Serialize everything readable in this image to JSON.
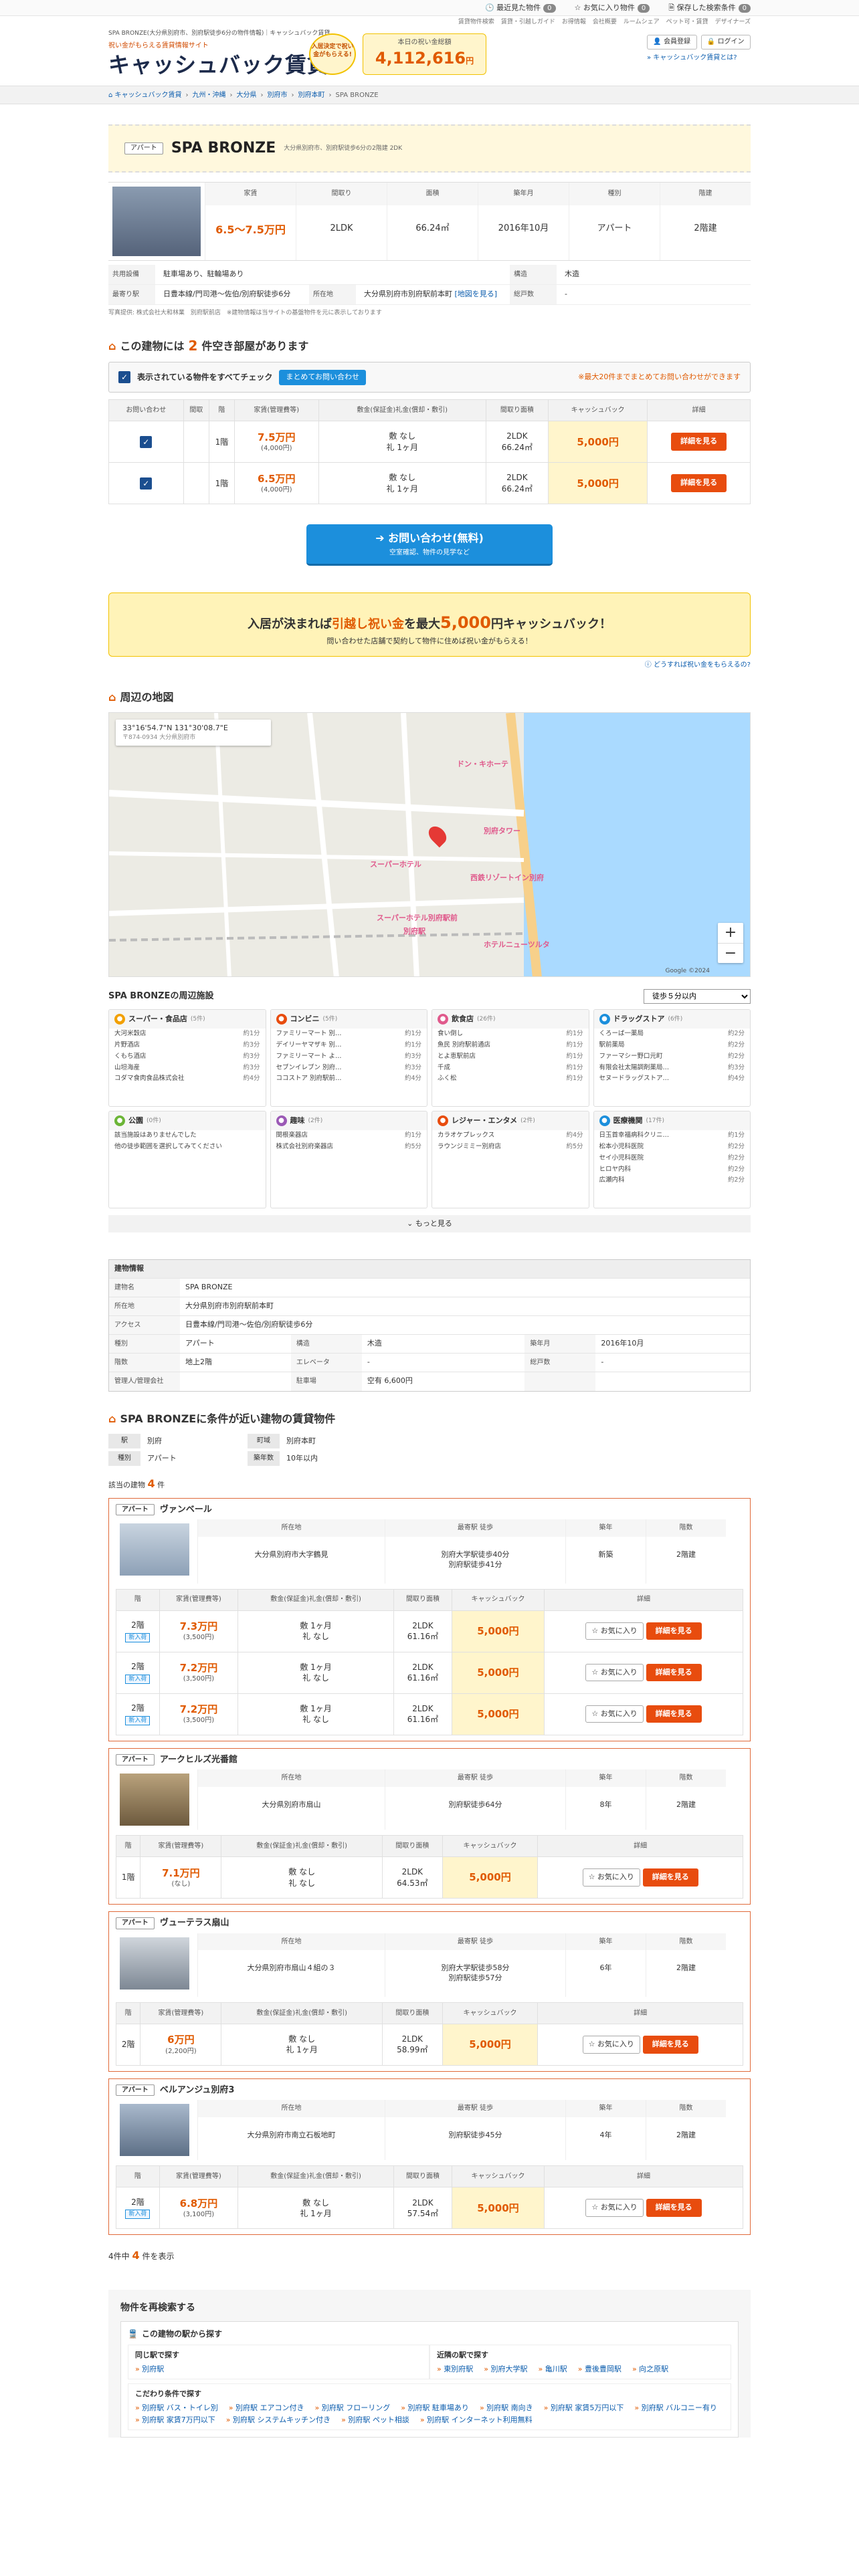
{
  "util": {
    "recent": "最近見た物件",
    "recent_count": "0",
    "fav": "お気に入り物件",
    "fav_count": "0",
    "saved": "保存した検索条件",
    "saved_count": "0"
  },
  "mini_links": [
    "賃貸物件検索",
    "賃貸・引越しガイド",
    "お得情報",
    "会社概要",
    "ルームシェア",
    "ペット可・賃貸",
    "デザイナーズ"
  ],
  "header": {
    "tagline": "SPA BRONZE(大分県別府市、別府駅徒歩6分の物件情報)｜キャッシュバック賃貸",
    "logo_sub": "祝い金がもらえる賃貸情報サイト",
    "logo": "キャッシュバック賃貸",
    "badge": "入居決定で祝い金がもらえる!",
    "total_cap": "本日の祝い金総額",
    "total_num": "4,112,616",
    "total_unit": "円",
    "member": "会員登録",
    "login": "ログイン",
    "about": "キャッシュバック賃貸とは?"
  },
  "breadcrumb": [
    "キャッシュバック賃貸",
    "九州・沖縄",
    "大分県",
    "別府市",
    "別府本町",
    "SPA BRONZE"
  ],
  "building": {
    "tag": "アパート",
    "name": "SPA BRONZE",
    "addr": "大分県別府市、別府駅徒歩6分の2階建 2DK",
    "price": "6.5〜7.5万円",
    "layout": "2LDK",
    "area": "66.24㎡",
    "built": "2016年10月",
    "type": "アパート",
    "floors": "2階建",
    "shared": "駐車場あり、駐輪場あり",
    "structure_k": "構造",
    "structure": "木造",
    "station_k": "最寄り駅",
    "station": "日豊本線/門司港〜佐伯/別府駅徒歩6分",
    "loc_k": "所在地",
    "loc": "大分県別府市別府駅前本町",
    "map_link": "[地図を見る]",
    "units_k": "総戸数",
    "units": "-",
    "note1": "写真提供: 株式会社大和林業　別府駅前店　※建物情報は当サイトの基盤物件を元に表示しております"
  },
  "sum_headers": [
    "家賃",
    "間取り",
    "面積",
    "築年月",
    "種別",
    "階建"
  ],
  "shared_k": "共用設備",
  "rooms_title_pre": "この建物には",
  "rooms_count": "2",
  "rooms_title_post": "件空き部屋があります",
  "checkbar": {
    "check_all": "表示されている物件をすべてチェック",
    "bulk": "まとめてお問い合わせ",
    "note": "※最大20件までまとめてお問い合わせができます"
  },
  "room_headers": [
    "お問い合わせ",
    "間取",
    "階",
    "家賃(管理費等)",
    "敷金(保証金)礼金(償却・敷引)",
    "間取り面積",
    "キャッシュバック",
    "詳細"
  ],
  "rooms": [
    {
      "floor": "1階",
      "rent": "7.5万円",
      "mgmt": "(4,000円)",
      "deposit": "敷 なし",
      "key": "礼 1ヶ月",
      "layout": "2LDK",
      "area": "66.24㎡",
      "cb": "5,000円",
      "detail": "詳細を見る"
    },
    {
      "floor": "1階",
      "rent": "6.5万円",
      "mgmt": "(4,000円)",
      "deposit": "敷 なし",
      "key": "礼 1ヶ月",
      "layout": "2LDK",
      "area": "66.24㎡",
      "cb": "5,000円",
      "detail": "詳細を見る"
    }
  ],
  "inquiry": {
    "main": "お問い合わせ(無料)",
    "sub": "空室確認、物件の見学など"
  },
  "banner": {
    "pre": "入居が決まれば",
    "hl": "引越し祝い金",
    "mid": "を最大",
    "amount": "5,000",
    "post": "円キャッシュバック！",
    "sub": "問い合わせた店舗で契約して物件に住めば祝い金がもらえる！",
    "link": "どうすれば祝い金をもらえるの?"
  },
  "map": {
    "title": "周辺の地図",
    "coord": "33°16'54.7\"N 131°30'08.7\"E",
    "coord_sub": "〒874-0934 大分県別府市",
    "labels": [
      "別府駅",
      "ドン・キホーテ",
      "スーパーホテル別府駅前",
      "ホテルニューツルタ",
      "西鉄リゾートイン別府",
      "スーパーホテル",
      "別府タワー"
    ],
    "copyright": "Google ©2024"
  },
  "near": {
    "title": "SPA BRONZEの周辺施設",
    "select": "徒歩５分以内",
    "more": "もっと見る",
    "cats": [
      {
        "name": "スーパー・食品店",
        "count": "(5件)",
        "items": [
          [
            "大河米穀店",
            "約1分"
          ],
          [
            "片野酒店",
            "約3分"
          ],
          [
            "くもち酒店",
            "約3分"
          ],
          [
            "山坦海産",
            "約3分"
          ],
          [
            "コダマ食肉食品株式会社",
            "約4分"
          ]
        ]
      },
      {
        "name": "コンビニ",
        "count": "(5件)",
        "items": [
          [
            "ファミリーマート 別…",
            "約1分"
          ],
          [
            "デイリーヤマザキ 別…",
            "約1分"
          ],
          [
            "ファミリーマート よ…",
            "約3分"
          ],
          [
            "セブンイレブン 別府…",
            "約3分"
          ],
          [
            "ココストア 別府駅前…",
            "約4分"
          ]
        ]
      },
      {
        "name": "飲食店",
        "count": "(26件)",
        "items": [
          [
            "食い倒し",
            "約1分"
          ],
          [
            "魚民 別府駅前通店",
            "約1分"
          ],
          [
            "とよ恵駅前店",
            "約1分"
          ],
          [
            "千成",
            "約1分"
          ],
          [
            "ふく松",
            "約1分"
          ]
        ]
      },
      {
        "name": "ドラッグストア",
        "count": "(6件)",
        "items": [
          [
            "くろーば一薬局",
            "約2分"
          ],
          [
            "駅前薬局",
            "約2分"
          ],
          [
            "ファーマシー野口元町",
            "約2分"
          ],
          [
            "有限会社太陽調剤薬局…",
            "約3分"
          ],
          [
            "セヌードラッグストア…",
            "約4分"
          ]
        ]
      },
      {
        "name": "公園",
        "count": "(0件)",
        "items": [
          [
            "該当施設はありませんでした",
            ""
          ],
          [
            "他の徒歩範囲を選択してみてください",
            ""
          ]
        ]
      },
      {
        "name": "趣味",
        "count": "(2件)",
        "items": [
          [
            "関根楽器店",
            "約1分"
          ],
          [
            "株式会社別府楽器店",
            "約5分"
          ]
        ]
      },
      {
        "name": "レジャー・エンタメ",
        "count": "(2件)",
        "items": [
          [
            "カラオケプレックス",
            "約4分"
          ],
          [
            "ラウンジミミー別府店",
            "約5分"
          ]
        ]
      },
      {
        "name": "医療機関",
        "count": "(17件)",
        "items": [
          [
            "日玉首幸福病科クリニ…",
            "約1分"
          ],
          [
            "松本小児科医院",
            "約2分"
          ],
          [
            "セイ小児科医院",
            "約2分"
          ],
          [
            "ヒロヤ内科",
            "約2分"
          ],
          [
            "広瀬内科",
            "約2分"
          ]
        ]
      }
    ]
  },
  "bi": {
    "title": "建物情報",
    "rows": [
      [
        "建物名",
        "SPA BRONZE"
      ],
      [
        "所在地",
        "大分県別府市別府駅前本町"
      ],
      [
        "アクセス",
        "日豊本線/門司港〜佐伯/別府駅徒歩6分"
      ]
    ],
    "grid": [
      [
        "種別",
        "アパート",
        "構造",
        "木造",
        "築年月",
        "2016年10月"
      ],
      [
        "階数",
        "地上2階",
        "エレベータ",
        "-",
        "総戸数",
        "-"
      ],
      [
        "管理人/管理会社",
        "",
        "駐車場",
        "空有 6,600円",
        "",
        ""
      ]
    ]
  },
  "similar": {
    "title_pre": "SPA BRONZEに条件が近い建物の賃貸物件",
    "cond": [
      [
        "駅",
        "別府",
        "町域",
        "別府本町"
      ],
      [
        "種別",
        "アパート",
        "築年数",
        "10年以内"
      ]
    ],
    "count_pre": "該当の建物",
    "count": "4",
    "count_post": "件",
    "col_heads": [
      "所在地",
      "最寄駅 徒歩",
      "築年",
      "階数"
    ],
    "room_heads": [
      "階",
      "家賃(管理費等)",
      "敷金(保証金)礼金(償却・敷引)",
      "間取り面積",
      "キャッシュバック",
      "詳細"
    ],
    "fav": "お気に入り",
    "detail": "詳細を見る",
    "new": "新入荷",
    "cards": [
      {
        "tag": "アパート",
        "name": "ヴァンベール",
        "addr": "大分県別府市大字鶴見",
        "station": "別府大学駅徒歩40分\n別府駅徒歩41分",
        "age": "新築",
        "floors": "2階建",
        "rooms": [
          {
            "floor": "2階",
            "new": true,
            "rent": "7.3万円",
            "mgmt": "(3,500円)",
            "dep": "敷 1ヶ月",
            "key": "礼 なし",
            "layout": "2LDK",
            "area": "61.16㎡",
            "cb": "5,000円"
          },
          {
            "floor": "2階",
            "new": true,
            "rent": "7.2万円",
            "mgmt": "(3,500円)",
            "dep": "敷 1ヶ月",
            "key": "礼 なし",
            "layout": "2LDK",
            "area": "61.16㎡",
            "cb": "5,000円"
          },
          {
            "floor": "2階",
            "new": true,
            "rent": "7.2万円",
            "mgmt": "(3,500円)",
            "dep": "敷 1ヶ月",
            "key": "礼 なし",
            "layout": "2LDK",
            "area": "61.16㎡",
            "cb": "5,000円"
          }
        ]
      },
      {
        "tag": "アパート",
        "name": "アークヒルズ光番館",
        "addr": "大分県別府市扇山",
        "station": "別府駅徒歩64分",
        "age": "8年",
        "floors": "2階建",
        "rooms": [
          {
            "floor": "1階",
            "new": false,
            "rent": "7.1万円",
            "mgmt": "(なし)",
            "dep": "敷 なし",
            "key": "礼 なし",
            "layout": "2LDK",
            "area": "64.53㎡",
            "cb": "5,000円"
          }
        ]
      },
      {
        "tag": "アパート",
        "name": "ヴューテラス扇山",
        "addr": "大分県別府市扇山４組の３",
        "station": "別府大学駅徒歩58分\n別府駅徒歩57分",
        "age": "6年",
        "floors": "2階建",
        "rooms": [
          {
            "floor": "2階",
            "new": false,
            "rent": "6万円",
            "mgmt": "(2,200円)",
            "dep": "敷 なし",
            "key": "礼 1ヶ月",
            "layout": "2LDK",
            "area": "58.99㎡",
            "cb": "5,000円"
          }
        ]
      },
      {
        "tag": "アパート",
        "name": "ベルアンジュ別府3",
        "addr": "大分県別府市南立石板地町",
        "station": "別府駅徒歩45分",
        "age": "4年",
        "floors": "2階建",
        "rooms": [
          {
            "floor": "2階",
            "new": true,
            "rent": "6.8万円",
            "mgmt": "(3,100円)",
            "dep": "敷 なし",
            "key": "礼 1ヶ月",
            "layout": "2LDK",
            "area": "57.54㎡",
            "cb": "5,000円"
          }
        ]
      }
    ],
    "footer_pre": "4件中",
    "footer_num": "4",
    "footer_post": "件を表示"
  },
  "research": {
    "title": "物件を再検索する",
    "box_title": "この建物の駅から探す",
    "same_line": "同じ駅で探す",
    "same_links": [
      "別府駅"
    ],
    "near_line": "近隣の駅で探す",
    "near_links": [
      "東別府駅",
      "別府大学駅",
      "亀川駅",
      "豊後豊岡駅",
      "向之原駅"
    ],
    "cond_title": "こだわり条件で探す",
    "cond_links": [
      "別府駅 バス・トイレ別",
      "別府駅 エアコン付き",
      "別府駅 フローリング",
      "別府駅 駐車場あり",
      "別府駅 南向き",
      "別府駅 家賃5万円以下",
      "別府駅 バルコニー有り",
      "別府駅 家賃7万円以下",
      "別府駅 システムキッチン付き",
      "別府駅 ペット相談",
      "別府駅 インターネット利用無料"
    ]
  }
}
